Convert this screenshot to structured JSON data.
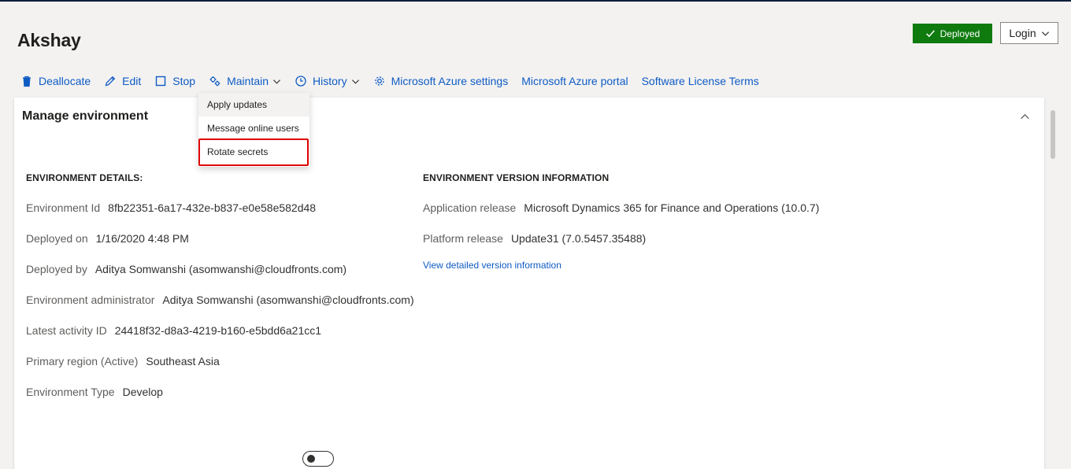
{
  "header": {
    "title": "Akshay",
    "status": {
      "label": "Deployed",
      "icon": "checkmark-icon",
      "color": "#0f7b0f"
    },
    "login": {
      "label": "Login",
      "icon": "chevron-down-icon"
    }
  },
  "toolbar": {
    "deallocate": "Deallocate",
    "edit": "Edit",
    "stop": "Stop",
    "maintain": "Maintain",
    "history": "History",
    "azure_settings": "Microsoft Azure settings",
    "azure_portal": "Microsoft Azure portal",
    "license_terms": "Software License Terms"
  },
  "maintain_menu": {
    "items": [
      {
        "label": "Apply updates",
        "state": "hovered"
      },
      {
        "label": "Message online users"
      },
      {
        "label": "Rotate secrets",
        "state": "highlighted"
      }
    ]
  },
  "card": {
    "title": "Manage environment",
    "environment_details": {
      "heading": "ENVIRONMENT DETAILS:",
      "rows": [
        {
          "label": "Environment Id",
          "value": "8fb22351-6a17-432e-b837-e0e58e582d48"
        },
        {
          "label": "Deployed on",
          "value": "1/16/2020 4:48 PM"
        },
        {
          "label": "Deployed by",
          "value": "Aditya Somwanshi (asomwanshi@cloudfronts.com)"
        },
        {
          "label": "Environment administrator",
          "value": "Aditya Somwanshi (asomwanshi@cloudfronts.com)"
        },
        {
          "label": "Latest activity ID",
          "value": "24418f32-d8a3-4219-b160-e5bdd6a21cc1"
        },
        {
          "label": "Primary region (Active)",
          "value": "Southeast Asia"
        },
        {
          "label": "Environment Type",
          "value": "Develop"
        }
      ]
    },
    "version_info": {
      "heading": "ENVIRONMENT VERSION INFORMATION",
      "rows": [
        {
          "label": "Application release",
          "value": "Microsoft Dynamics 365 for Finance and Operations (10.0.7)"
        },
        {
          "label": "Platform release",
          "value": "Update31 (7.0.5457.35488)"
        }
      ],
      "link": "View detailed version information"
    },
    "toggle": {
      "state": "off"
    }
  },
  "colors": {
    "link": "#0f5bc4",
    "deployed_badge": "#0f7b0f",
    "highlight_border": "#e00000",
    "page_background": "#f3f2f1"
  }
}
